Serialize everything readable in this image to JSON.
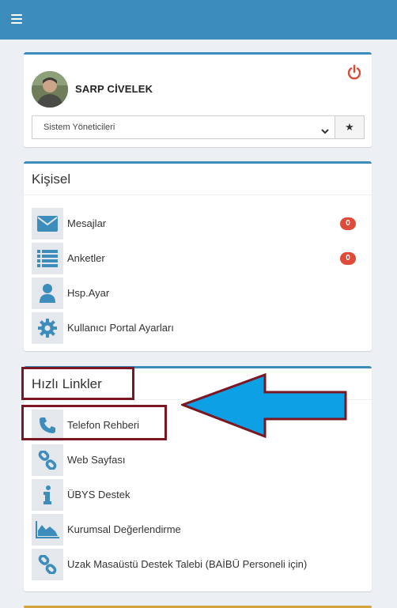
{
  "header": {
    "menu_icon": "hamburger-icon",
    "accent_color": "#3c8dbc"
  },
  "profile": {
    "user_name": "SARP CİVELEK",
    "power_icon": "power-icon",
    "role_selected": "Sistem Yöneticileri",
    "star_icon": "star-icon"
  },
  "personal": {
    "title": "Kişisel",
    "items": [
      {
        "label": "Mesajlar",
        "icon": "envelope-icon",
        "badge": "0"
      },
      {
        "label": "Anketler",
        "icon": "list-icon",
        "badge": "0"
      },
      {
        "label": "Hsp.Ayar",
        "icon": "user-icon"
      },
      {
        "label": "Kullanıcı Portal Ayarları",
        "icon": "gear-icon"
      }
    ]
  },
  "quick_links": {
    "title": "Hızlı Linkler",
    "items": [
      {
        "label": "Telefon Rehberi",
        "icon": "phone-icon"
      },
      {
        "label": "Web Sayfası",
        "icon": "link-icon"
      },
      {
        "label": "ÜBYS Destek",
        "icon": "info-icon"
      },
      {
        "label": "Kurumsal Değerlendirme",
        "icon": "area-chart-icon"
      },
      {
        "label": "Uzak Masaüstü Destek Talebi (BAİBÜ Personeli için)",
        "icon": "link-icon"
      }
    ]
  },
  "colors": {
    "icon_blue": "#3c8dbc",
    "badge_red": "#dd4b39",
    "highlight": "#7b1722",
    "arrow_blue": "#0da0e4"
  }
}
